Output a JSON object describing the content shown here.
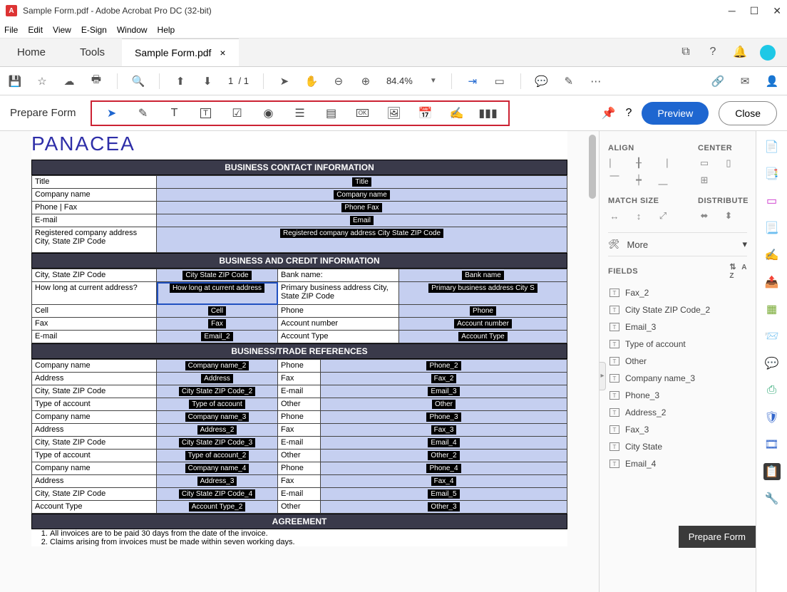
{
  "window": {
    "title": "Sample Form.pdf - Adobe Acrobat Pro DC (32-bit)"
  },
  "menu": {
    "file": "File",
    "edit": "Edit",
    "view": "View",
    "esign": "E-Sign",
    "window": "Window",
    "help": "Help"
  },
  "tabs": {
    "home": "Home",
    "tools": "Tools",
    "doc": "Sample Form.pdf"
  },
  "toolbar": {
    "page_current": "1",
    "page_sep": "/",
    "page_total": "1",
    "zoom": "84.4%"
  },
  "prepare": {
    "label": "Prepare Form",
    "preview": "Preview",
    "close": "Close"
  },
  "doc": {
    "brand": "PANACEA",
    "sec1": "BUSINESS CONTACT INFORMATION",
    "sec2": "BUSINESS AND CREDIT INFORMATION",
    "sec3": "BUSINESS/TRADE REFERENCES",
    "sec4": "AGREEMENT",
    "rows1": [
      {
        "l": "Title",
        "f": "Title"
      },
      {
        "l": "Company name",
        "f": "Company name"
      },
      {
        "l": "Phone | Fax",
        "f": "Phone  Fax"
      },
      {
        "l": "E-mail",
        "f": "Email"
      },
      {
        "l": "Registered company address City, State ZIP Code",
        "f": "Registered company address City State ZIP Code"
      }
    ],
    "rows2": [
      {
        "l": "City, State ZIP Code",
        "f": "City State ZIP Code",
        "l2": "Bank name:",
        "f2": "Bank name"
      },
      {
        "l": "How long at current address?",
        "f": "How long at current address",
        "l2": "Primary business address City, State ZIP Code",
        "f2": "Primary business address City S"
      },
      {
        "l": "Cell",
        "f": "Cell",
        "l2": "Phone",
        "f2": "Phone"
      },
      {
        "l": "Fax",
        "f": "Fax",
        "l2": "Account number",
        "f2": "Account number"
      },
      {
        "l": "E-mail",
        "f": "Email_2",
        "l2": "Account Type",
        "f2": "Account Type"
      }
    ],
    "rows3": [
      {
        "l": "Company name",
        "f": "Company name_2",
        "l2": "Phone",
        "f2": "Phone_2"
      },
      {
        "l": "Address",
        "f": "Address",
        "l2": "Fax",
        "f2": "Fax_2"
      },
      {
        "l": "City, State ZIP Code",
        "f": "City State ZIP Code_2",
        "l2": "E-mail",
        "f2": "Email_3"
      },
      {
        "l": "Type of account",
        "f": "Type of account",
        "l2": "Other",
        "f2": "Other"
      },
      {
        "l": "Company name",
        "f": "Company name_3",
        "l2": "Phone",
        "f2": "Phone_3"
      },
      {
        "l": "Address",
        "f": "Address_2",
        "l2": "Fax",
        "f2": "Fax_3"
      },
      {
        "l": "City, State ZIP Code",
        "f": "City State ZIP Code_3",
        "l2": "E-mail",
        "f2": "Email_4"
      },
      {
        "l": "Type of account",
        "f": "Type of account_2",
        "l2": "Other",
        "f2": "Other_2"
      },
      {
        "l": "Company name",
        "f": "Company name_4",
        "l2": "Phone",
        "f2": "Phone_4"
      },
      {
        "l": "Address",
        "f": "Address_3",
        "l2": "Fax",
        "f2": "Fax_4"
      },
      {
        "l": "City, State ZIP Code",
        "f": "City State ZIP Code_4",
        "l2": "E-mail",
        "f2": "Email_5"
      },
      {
        "l": "Account Type",
        "f": "Account Type_2",
        "l2": "Other",
        "f2": "Other_3"
      }
    ],
    "agreement": [
      "All invoices are to be paid 30 days from the date of the invoice.",
      "Claims arising from invoices must be made within seven working days."
    ]
  },
  "panel": {
    "align": "ALIGN",
    "center": "CENTER",
    "match": "MATCH SIZE",
    "dist": "DISTRIBUTE",
    "more": "More",
    "fields": "FIELDS",
    "fieldlist": [
      "Fax_2",
      "City State ZIP Code_2",
      "Email_3",
      "Type of account",
      "Other",
      "Company name_3",
      "Phone_3",
      "Address_2",
      "Fax_3",
      "City State",
      "Email_4"
    ]
  },
  "tooltip": "Prepare Form"
}
